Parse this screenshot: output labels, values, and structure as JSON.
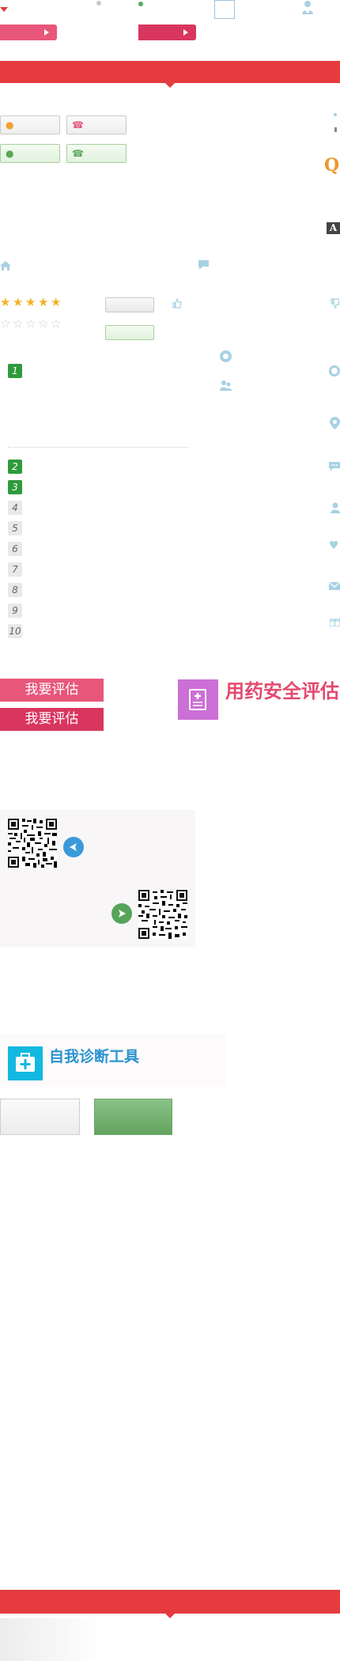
{
  "evaluation": {
    "button_label": "我要评估",
    "button_label_hover": "我要评估",
    "banner_title": "用药安全评估"
  },
  "diagnosis": {
    "title": "自我诊断工具"
  },
  "ranking": {
    "numbers": [
      "1",
      "2",
      "3",
      "4",
      "5",
      "6",
      "7",
      "8",
      "9",
      "10"
    ]
  },
  "side_icons": {
    "search_glyph": "Q",
    "font_glyph": "A"
  },
  "ratings": {
    "filled_stars": 5,
    "max_stars": 5
  },
  "colors": {
    "brand_red": "#e53b3f",
    "button_pink": "#e8567a",
    "button_pink_dark": "#d9365f",
    "banner_purple": "#cc6fd6",
    "diag_blue": "#12b8e0",
    "active_green": "#2f9a3c"
  }
}
